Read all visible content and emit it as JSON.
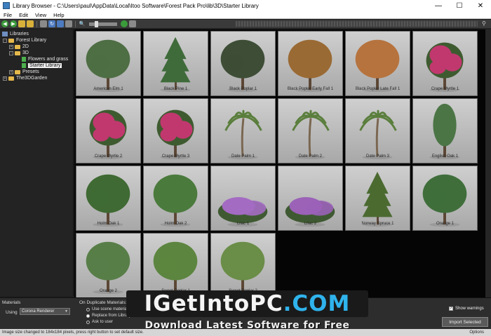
{
  "window": {
    "title": "Library Browser - C:\\Users\\paul\\AppData\\Local\\Itoo Software\\Forest Pack Pro\\lib\\3D\\Starter Library",
    "minimize": "—",
    "maximize": "☐",
    "close": "✕"
  },
  "menu": [
    "File",
    "Edit",
    "View",
    "Help"
  ],
  "tree": {
    "root": "Libraries",
    "forest_library": "Forest Library",
    "folder_2d": "2D",
    "folder_3d": "3D",
    "flowers": "Flowers and grass",
    "starter": "Starter Library",
    "presets": "Presets",
    "the3dgarden": "The3DGarden"
  },
  "items": [
    {
      "label": "American Elm 1",
      "kind": "round",
      "foliage": "#4e6e44"
    },
    {
      "label": "Black Pine 1",
      "kind": "conifer",
      "foliage": "#3f6b3a"
    },
    {
      "label": "Black Poplar 1",
      "kind": "round",
      "foliage": "#3d4d36"
    },
    {
      "label": "Black Poplar Early Fall 1",
      "kind": "round",
      "foliage": "#9a6a34"
    },
    {
      "label": "Black Poplar Late Fall 1",
      "kind": "round",
      "foliage": "#b6733e"
    },
    {
      "label": "Crape Myrtle 1",
      "kind": "flower",
      "foliage": "#c1386f"
    },
    {
      "label": "Crape Myrtle 2",
      "kind": "flower",
      "foliage": "#c1386f"
    },
    {
      "label": "Crape Myrtle 3",
      "kind": "flower",
      "foliage": "#c1386f"
    },
    {
      "label": "Date Palm 1",
      "kind": "palm",
      "foliage": "#5a7e3c"
    },
    {
      "label": "Date Palm 2",
      "kind": "palm",
      "foliage": "#5a7e3c"
    },
    {
      "label": "Date Palm 3",
      "kind": "palm",
      "foliage": "#5a7e3c"
    },
    {
      "label": "English Oak 1",
      "kind": "tall",
      "foliage": "#4b7545"
    },
    {
      "label": "Holm Oak 1",
      "kind": "round",
      "foliage": "#3f6a33"
    },
    {
      "label": "Holm Oak 2",
      "kind": "round",
      "foliage": "#4a7a3c"
    },
    {
      "label": "Lilac 1",
      "kind": "bush",
      "foliage": "#a46bc3"
    },
    {
      "label": "Lilac 2",
      "kind": "bush",
      "foliage": "#9b62b8"
    },
    {
      "label": "Norway Spruce 1",
      "kind": "conifer",
      "foliage": "#4b6a30"
    },
    {
      "label": "Orange 1",
      "kind": "round",
      "foliage": "#3f6e3b"
    },
    {
      "label": "Orange 2",
      "kind": "round",
      "foliage": "#587e48"
    },
    {
      "label": "Sweet Poplar 1",
      "kind": "round",
      "foliage": "#5c853f"
    },
    {
      "label": "Sweet Poplar 2",
      "kind": "round",
      "foliage": "#6a8d47"
    }
  ],
  "bottom": {
    "materials_label": "Materials",
    "using_label": "Using",
    "renderer": "Corona Renderer",
    "duplicate_label": "On Duplicate Materials:",
    "opt_use_scene": "Use scene material",
    "opt_replace": "Replace from Library",
    "opt_ask": "Ask to user",
    "show_warnings": "Show warnings",
    "import_button": "Import Selected"
  },
  "status": {
    "message": "Image size changed to 184x184 pixels, press right button to set default size.",
    "options": "Options"
  },
  "watermark": {
    "brand": "IGetIntoPC",
    "tld": ".COM",
    "tagline": "Download Latest Software for Free"
  }
}
